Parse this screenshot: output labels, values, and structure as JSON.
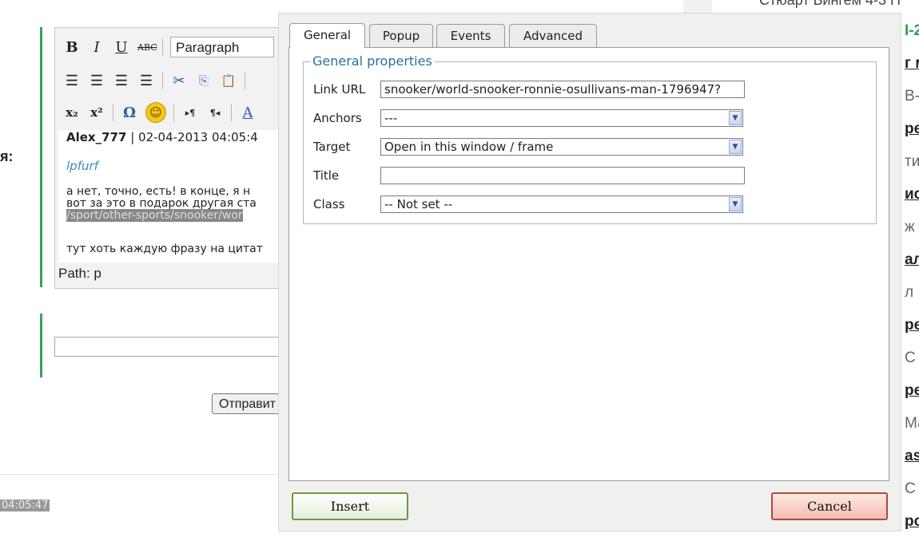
{
  "background": {
    "left_label": "я:",
    "editor": {
      "format_select": "Paragraph",
      "author": "Alex_777",
      "author_date": "| 02-04-2013 04:05:4",
      "quote": "lpfurf",
      "body_line1": " а нет, точно, есть! в конце, я н",
      "body_line2": "вот за это в подарок другая ста",
      "body_line3": "/sport/other-sports/snooker/wor",
      "body_line4": "тут хоть каждую фразу на цитат",
      "path": "Path: p"
    },
    "send_button": "Отправит",
    "timestamp": "04:05:47",
    "top_peek_text": "Стюарт Бингем 4-3 Н",
    "right_column": [
      "I-2",
      "г м",
      "В-",
      "ре",
      "ти",
      "ис",
      "ж",
      "ал",
      "л",
      "ре",
      "С",
      "ре",
      "Ма",
      "as",
      "С",
      "ро"
    ]
  },
  "dialog": {
    "tabs": [
      "General",
      "Popup",
      "Events",
      "Advanced"
    ],
    "active_tab": "General",
    "legend": "General properties",
    "fields": {
      "link_url": {
        "label": "Link URL",
        "value": "snooker/world-snooker-ronnie-osullivans-man-1796947?"
      },
      "anchors": {
        "label": "Anchors",
        "value": "---"
      },
      "target": {
        "label": "Target",
        "value": "Open in this window / frame"
      },
      "title": {
        "label": "Title",
        "value": ""
      },
      "class": {
        "label": "Class",
        "value": "-- Not set --"
      }
    },
    "insert_label": "Insert",
    "cancel_label": "Cancel"
  }
}
